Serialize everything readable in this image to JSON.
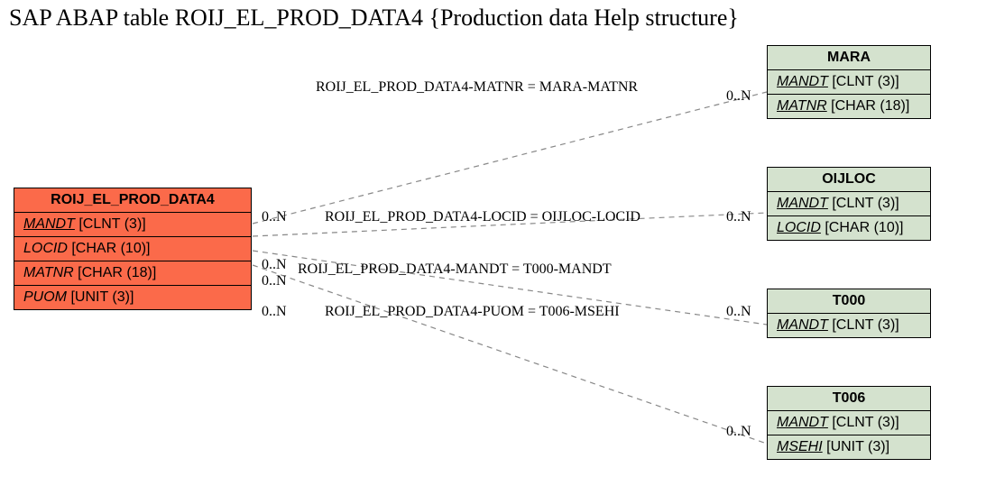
{
  "title": "SAP ABAP table ROIJ_EL_PROD_DATA4 {Production data Help structure}",
  "main": {
    "name": "ROIJ_EL_PROD_DATA4",
    "fields": [
      {
        "name": "MANDT",
        "type": "[CLNT (3)]",
        "key": true
      },
      {
        "name": "LOCID",
        "type": "[CHAR (10)]",
        "key": false
      },
      {
        "name": "MATNR",
        "type": "[CHAR (18)]",
        "key": false
      },
      {
        "name": "PUOM",
        "type": "[UNIT (3)]",
        "key": false
      }
    ]
  },
  "refs": {
    "mara": {
      "name": "MARA",
      "fields": [
        {
          "name": "MANDT",
          "type": "[CLNT (3)]",
          "key": true
        },
        {
          "name": "MATNR",
          "type": "[CHAR (18)]",
          "key": true
        }
      ]
    },
    "oijloc": {
      "name": "OIJLOC",
      "fields": [
        {
          "name": "MANDT",
          "type": "[CLNT (3)]",
          "key": true
        },
        {
          "name": "LOCID",
          "type": "[CHAR (10)]",
          "key": true
        }
      ]
    },
    "t000": {
      "name": "T000",
      "fields": [
        {
          "name": "MANDT",
          "type": "[CLNT (3)]",
          "key": true
        }
      ]
    },
    "t006": {
      "name": "T006",
      "fields": [
        {
          "name": "MANDT",
          "type": "[CLNT (3)]",
          "key": true
        },
        {
          "name": "MSEHI",
          "type": "[UNIT (3)]",
          "key": true
        }
      ]
    }
  },
  "relations": {
    "r1": {
      "label": "ROIJ_EL_PROD_DATA4-MATNR = MARA-MATNR",
      "left_card": "0..N",
      "right_card": "0..N"
    },
    "r2": {
      "label": "ROIJ_EL_PROD_DATA4-LOCID = OIJLOC-LOCID",
      "left_card": "0..N",
      "right_card": "0..N"
    },
    "r3": {
      "label": "ROIJ_EL_PROD_DATA4-MANDT = T000-MANDT",
      "left_card": "0..N",
      "right_card": "0..N"
    },
    "r4": {
      "label": "ROIJ_EL_PROD_DATA4-PUOM = T006-MSEHI",
      "left_card": "0..N",
      "right_card": "0..N"
    }
  }
}
